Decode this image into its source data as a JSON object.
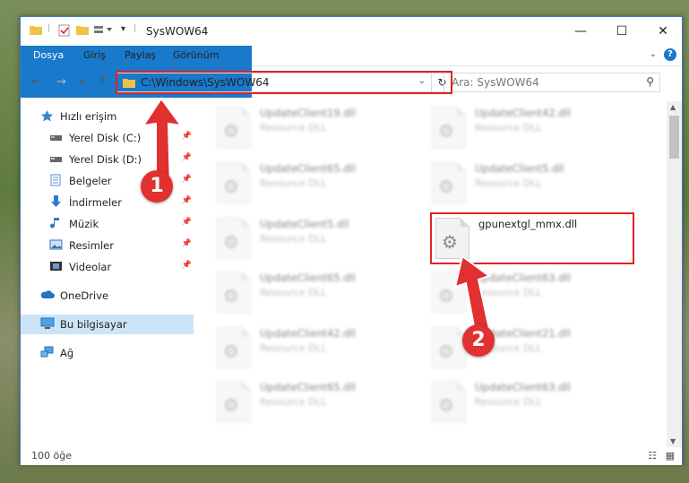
{
  "window": {
    "title": "SysWOW64",
    "quick_access_icons": [
      "folder-icon",
      "properties-check-icon",
      "new-folder-icon",
      "customize-icon"
    ],
    "controls": {
      "minimize": "—",
      "maximize": "☐",
      "close": "✕"
    }
  },
  "ribbon": {
    "tabs": [
      "Dosya",
      "Giriş",
      "Paylaş",
      "Görünüm"
    ]
  },
  "address": {
    "path": "C:\\Windows\\SysWOW64",
    "search_placeholder": "Ara: SysWOW64"
  },
  "nav": {
    "items": [
      {
        "label": "Hızlı erişim",
        "icon": "star-icon",
        "pinned": false
      },
      {
        "label": "Yerel Disk (C:)",
        "icon": "drive-icon",
        "pinned": true
      },
      {
        "label": "Yerel Disk (D:)",
        "icon": "drive-icon",
        "pinned": true
      },
      {
        "label": "Belgeler",
        "icon": "documents-icon",
        "pinned": true
      },
      {
        "label": "İndirmeler",
        "icon": "download-icon",
        "pinned": true
      },
      {
        "label": "Müzik",
        "icon": "music-icon",
        "pinned": true
      },
      {
        "label": "Resimler",
        "icon": "pictures-icon",
        "pinned": true
      },
      {
        "label": "Videolar",
        "icon": "videos-icon",
        "pinned": true
      },
      {
        "label": "OneDrive",
        "icon": "cloud-icon",
        "pinned": false
      },
      {
        "label": "Bu bilgisayar",
        "icon": "computer-icon",
        "pinned": false,
        "selected": true
      },
      {
        "label": "Ağ",
        "icon": "network-icon",
        "pinned": false
      }
    ]
  },
  "files": [
    {
      "name": "UpdateClient19.dll",
      "type": "Resource DLL"
    },
    {
      "name": "UpdateClient42.dll",
      "type": "Resource DLL"
    },
    {
      "name": "UpdateClient65.dll",
      "type": "Resource DLL"
    },
    {
      "name": "UpdateClient5.dll",
      "type": "Resource DLL"
    },
    {
      "name": "UpdateClient5.dll",
      "type": "Resource DLL"
    },
    {
      "name": "gpunextgl_mmx.dll",
      "type": "",
      "highlighted": true
    },
    {
      "name": "UpdateClient65.dll",
      "type": "Resource DLL"
    },
    {
      "name": "UpdateClient63.dll",
      "type": "Resource DLL"
    },
    {
      "name": "UpdateClient42.dll",
      "type": "Resource DLL"
    },
    {
      "name": "UpdateClient21.dll",
      "type": "Resource DLL"
    },
    {
      "name": "UpdateClient65.dll",
      "type": "Resource DLL"
    },
    {
      "name": "UpdateClient63.dll",
      "type": "Resource DLL"
    }
  ],
  "status": {
    "count": "100 öğe"
  },
  "annotations": {
    "step1": "1",
    "step2": "2",
    "accent": "#e03030"
  }
}
